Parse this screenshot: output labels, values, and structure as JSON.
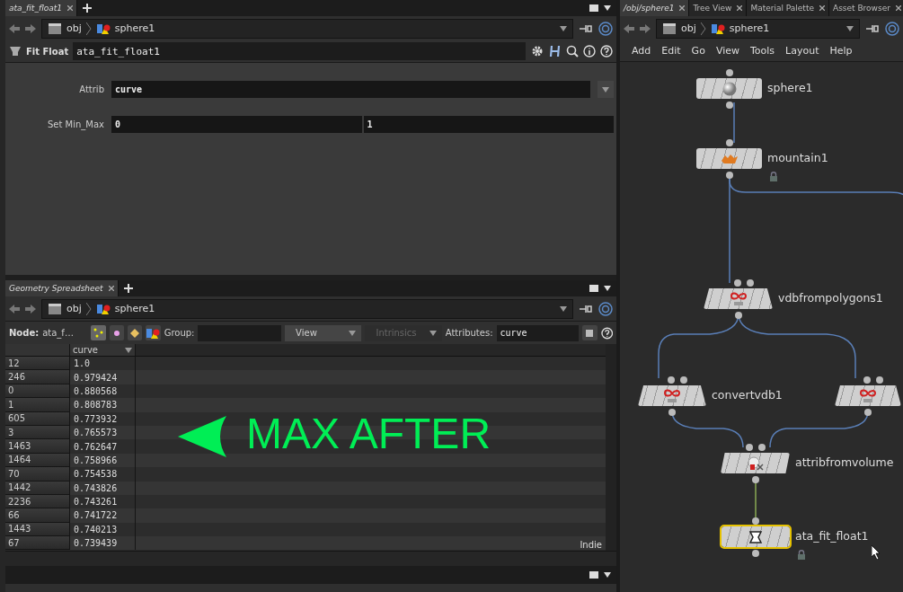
{
  "parameter_pane": {
    "tabs": [
      {
        "label": "ata_fit_float1",
        "selected": true
      }
    ],
    "path": [
      "obj",
      "sphere1"
    ],
    "node_type": "Fit Float",
    "node_name": "ata_fit_float1",
    "parameters": [
      {
        "label": "Attrib",
        "kind": "menu",
        "values": [
          "curve"
        ]
      },
      {
        "label": "Set Min_Max",
        "kind": "pair",
        "values": [
          "0",
          "1"
        ]
      }
    ]
  },
  "spreadsheet": {
    "tabs": [
      {
        "label": "Geometry Spreadsheet",
        "selected": true
      }
    ],
    "path": [
      "obj",
      "sphere1"
    ],
    "node_label": "Node:",
    "node_value": "ata_f…",
    "group_label": "Group:",
    "view_button": "View",
    "intrinsics": {
      "label": "Intrinsics",
      "disabled": true
    },
    "attributes_label": "Attributes:",
    "attributes_value": "curve",
    "columns": [
      "",
      "curve"
    ],
    "rows": [
      [
        "12",
        "1.0"
      ],
      [
        "246",
        "0.979424"
      ],
      [
        "0",
        "0.880568"
      ],
      [
        "1",
        "0.808783"
      ],
      [
        "605",
        "0.773932"
      ],
      [
        "3",
        "0.765573"
      ],
      [
        "1463",
        "0.762647"
      ],
      [
        "1464",
        "0.758966"
      ],
      [
        "70",
        "0.754538"
      ],
      [
        "1442",
        "0.743826"
      ],
      [
        "2236",
        "0.743261"
      ],
      [
        "66",
        "0.741722"
      ],
      [
        "1443",
        "0.740213"
      ],
      [
        "67",
        "0.739439"
      ]
    ],
    "edition": "Indie"
  },
  "annotation": {
    "text": "MAX AFTER"
  },
  "network_pane": {
    "tabs": [
      {
        "label": "/obj/sphere1",
        "selected": true
      },
      {
        "label": "Tree View",
        "selected": false
      },
      {
        "label": "Material Palette",
        "selected": false
      },
      {
        "label": "Asset Browser",
        "selected": false
      }
    ],
    "path": [
      "obj",
      "sphere1"
    ],
    "menu": [
      "Add",
      "Edit",
      "Go",
      "View",
      "Tools",
      "Layout",
      "Help"
    ],
    "nodes": [
      {
        "name": "sphere1",
        "kind": "sphere",
        "locked": false,
        "selected": false
      },
      {
        "name": "mountain1",
        "kind": "mountain",
        "locked": true,
        "selected": false
      },
      {
        "name": "vdbfrompolygons1",
        "kind": "vdb",
        "locked": false,
        "selected": false
      },
      {
        "name": "convertvdb1",
        "kind": "vdb",
        "locked": false,
        "selected": false
      },
      {
        "kind": "vdb",
        "locked": false,
        "selected": false
      },
      {
        "name": "attribfromvolume",
        "kind": "attrib",
        "locked": false,
        "selected": false
      },
      {
        "name": "ata_fit_float1",
        "kind": "fit",
        "locked": true,
        "selected": true
      }
    ]
  }
}
